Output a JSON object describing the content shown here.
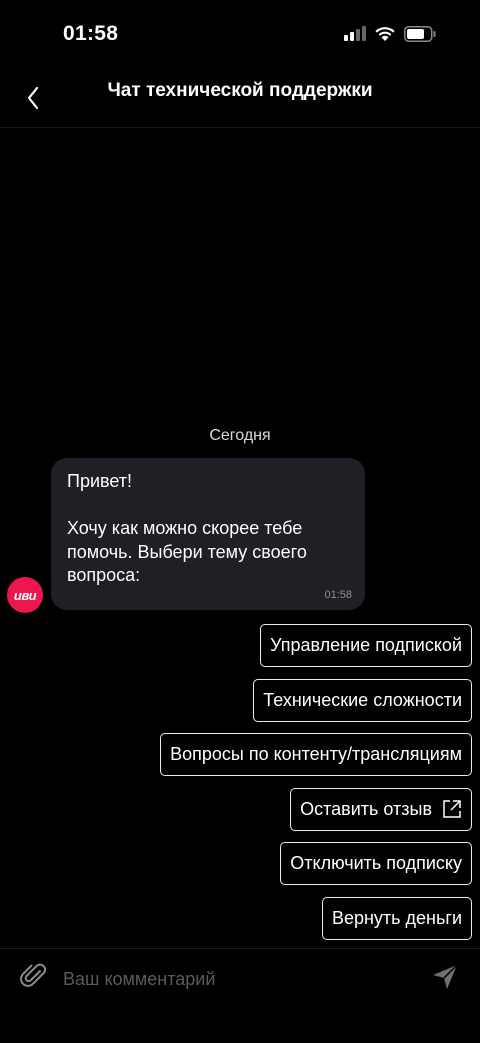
{
  "status_bar": {
    "time": "01:58"
  },
  "header": {
    "title": "Чат технической поддержки",
    "back_icon": "chevron-left-icon"
  },
  "chat": {
    "day_label": "Сегодня",
    "avatar_logo": "иви",
    "message": {
      "text": "Привет!\n\nХочу как можно скорее тебе помочь. Выбери тему своего вопроса:",
      "time": "01:58"
    },
    "options": [
      {
        "label": "Управление подпиской",
        "external": false
      },
      {
        "label": "Технические сложности",
        "external": false
      },
      {
        "label": "Вопросы по контенту/трансляциям",
        "external": false
      },
      {
        "label": "Оставить отзыв",
        "external": true
      },
      {
        "label": "Отключить подписку",
        "external": false
      },
      {
        "label": "Вернуть деньги",
        "external": false
      }
    ]
  },
  "input_bar": {
    "placeholder": "Ваш комментарий",
    "attach_icon": "paperclip-icon",
    "send_icon": "send-icon"
  },
  "colors": {
    "background": "#000000",
    "bubble": "#1f1f25",
    "brand": "#ec174f",
    "option_border": "#ececec"
  }
}
